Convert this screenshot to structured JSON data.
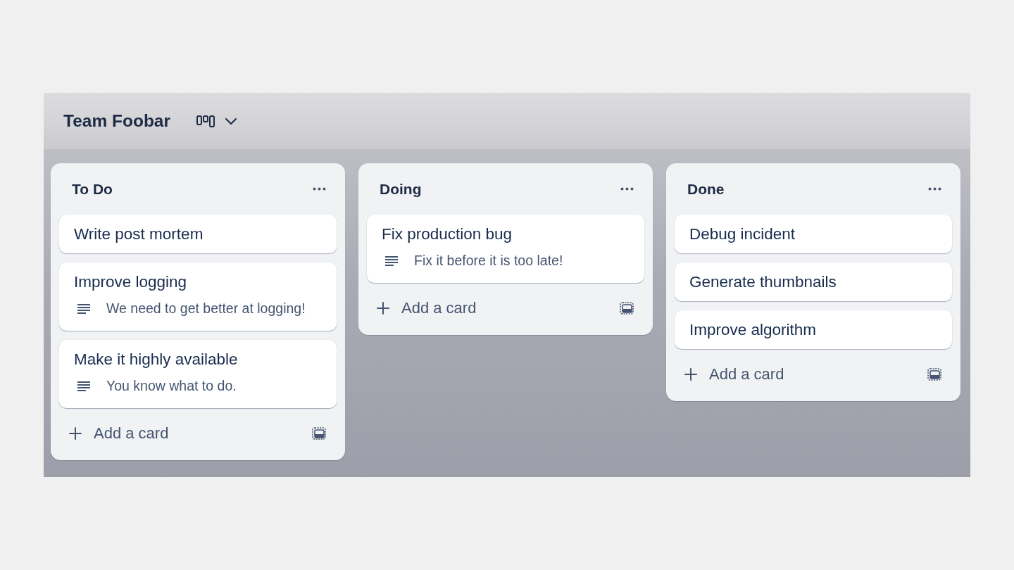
{
  "board": {
    "title": "Team Foobar"
  },
  "lists": [
    {
      "title": "To Do",
      "cards": [
        {
          "title": "Write post mortem"
        },
        {
          "title": "Improve logging",
          "description": "We need to get better at logging!"
        },
        {
          "title": "Make it highly available",
          "description": "You know what to do."
        }
      ],
      "add_label": "Add a card"
    },
    {
      "title": "Doing",
      "cards": [
        {
          "title": "Fix production bug",
          "description": "Fix it before it is too late!"
        }
      ],
      "add_label": "Add a card"
    },
    {
      "title": "Done",
      "cards": [
        {
          "title": "Debug incident"
        },
        {
          "title": "Generate thumbnails"
        },
        {
          "title": "Improve algorithm"
        }
      ],
      "add_label": "Add a card"
    }
  ]
}
